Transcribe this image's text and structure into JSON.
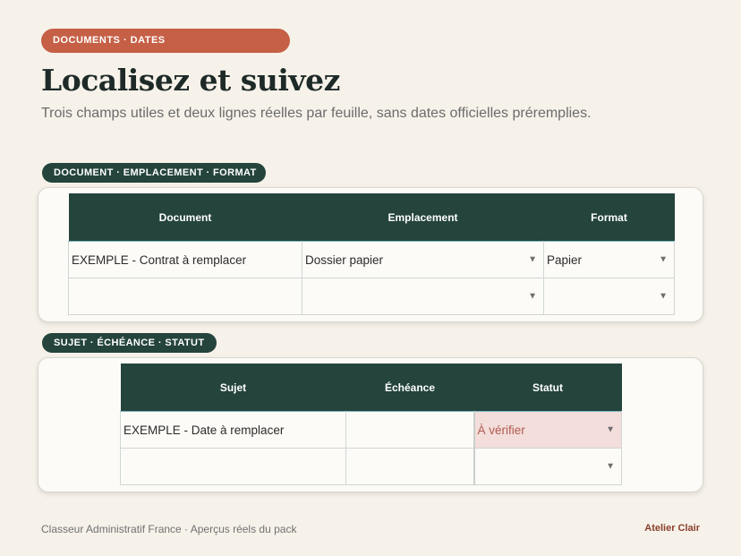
{
  "header": {
    "tag": "DOCUMENTS · DATES",
    "title": "Localisez et suivez",
    "subtitle": "Trois champs utiles et deux lignes réelles par feuille, sans dates officielles préremplies."
  },
  "section1": {
    "label": "DOCUMENT · EMPLACEMENT · FORMAT",
    "columns": [
      "Document",
      "Emplacement",
      "Format"
    ],
    "rows": [
      {
        "document": "EXEMPLE - Contrat à remplacer",
        "emplacement": "Dossier papier",
        "format": "Papier"
      },
      {
        "document": "",
        "emplacement": "",
        "format": ""
      }
    ]
  },
  "section2": {
    "label": "SUJET · ÉCHÉANCE · STATUT",
    "columns": [
      "Sujet",
      "Échéance",
      "Statut"
    ],
    "rows": [
      {
        "sujet": "EXEMPLE - Date à remplacer",
        "echeance": "",
        "statut": "À vérifier"
      },
      {
        "sujet": "",
        "echeance": "",
        "statut": ""
      }
    ]
  },
  "footer": {
    "left": "Classeur Administratif France · Aperçus réels du pack",
    "right": "Atelier Clair"
  },
  "icons": {
    "dropdown": "dropdown-arrow-icon"
  },
  "colors": {
    "accent": "#c55f46",
    "dark_green": "#24443c",
    "background": "#f6f2ea",
    "status_fill": "#f3dedb",
    "status_text": "#b05a52",
    "brand_text": "#8a3f2a"
  }
}
